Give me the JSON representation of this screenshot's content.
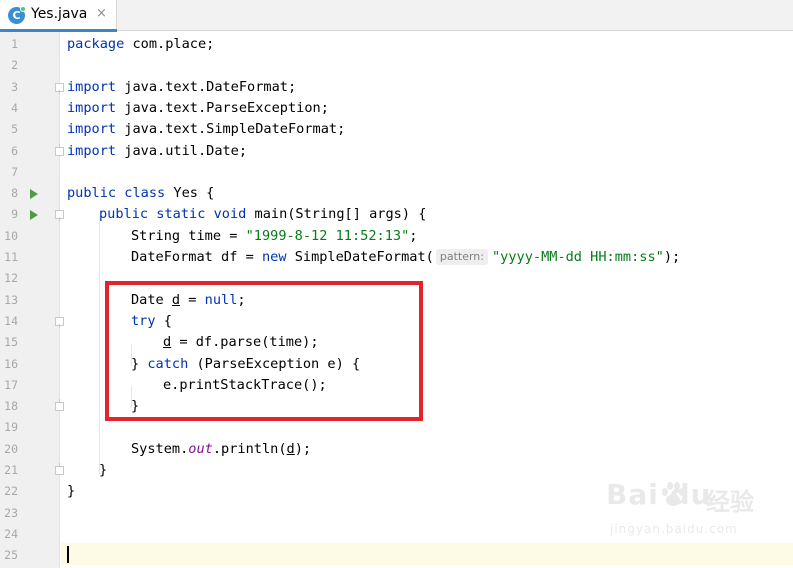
{
  "tab": {
    "icon": "java-class-icon",
    "icon_letter": "C",
    "title": "Yes.java",
    "close": "×"
  },
  "gutter": {
    "line_numbers": [
      "1",
      "2",
      "3",
      "4",
      "5",
      "6",
      "7",
      "8",
      "9",
      "10",
      "11",
      "12",
      "13",
      "14",
      "15",
      "16",
      "17",
      "18",
      "19",
      "20",
      "21",
      "22",
      "23",
      "24",
      "25"
    ],
    "run_lines": [
      8,
      9
    ]
  },
  "code": {
    "l1": {
      "t0": "package",
      "t1": " com.place;"
    },
    "l3": {
      "t0": "import",
      "t1": " java.text.DateFormat;"
    },
    "l4": {
      "t0": "import",
      "t1": " java.text.ParseException;"
    },
    "l5": {
      "t0": "import",
      "t1": " java.text.SimpleDateFormat;"
    },
    "l6": {
      "t0": "import",
      "t1": " java.util.Date;"
    },
    "l8": {
      "t0": "public class",
      "t1": " Yes {"
    },
    "l9": {
      "t0": "public static void",
      "t1": " main(String[] args) {"
    },
    "l10": {
      "t0": "String time = ",
      "t1": "\"1999-8-12 11:52:13\"",
      "t2": ";"
    },
    "l11": {
      "t0": "DateFormat df = ",
      "t1": "new",
      "t2": " SimpleDateFormat(",
      "hint": "pattern:",
      "t3": "\"yyyy-MM-dd HH:mm:ss\"",
      "t4": ");"
    },
    "l13": {
      "t0": "Date ",
      "t1": "d",
      "t2": " = ",
      "t3": "null",
      "t4": ";"
    },
    "l14": {
      "t0": "try",
      "t1": " {"
    },
    "l15": {
      "t0": "d",
      "t1": " = df.parse(time);"
    },
    "l16": {
      "t0": "} ",
      "t1": "catch",
      "t2": " (ParseException e) {"
    },
    "l17": {
      "t0": "e.printStackTrace();"
    },
    "l18": {
      "t0": "}"
    },
    "l20": {
      "t0": "System.",
      "t1": "out",
      "t2": ".println(",
      "t3": "d",
      "t4": ");"
    },
    "l21": {
      "t0": "}"
    },
    "l22": {
      "t0": "}"
    }
  },
  "watermark": {
    "brand": "Bai du",
    "cn": "经验",
    "url": "jingyan.baidu.com"
  },
  "colors": {
    "keyword": "#0033b3",
    "string": "#067d17",
    "static_field": "#871094",
    "highlight_box": "#e3242b",
    "current_line": "#fffae3"
  }
}
